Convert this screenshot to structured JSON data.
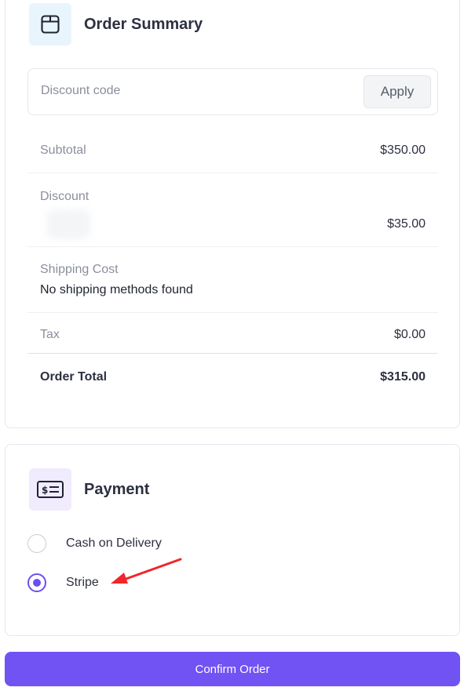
{
  "order_summary": {
    "title": "Order Summary",
    "icon": "box-icon",
    "discount": {
      "placeholder": "Discount code",
      "value": "",
      "apply_label": "Apply"
    },
    "rows": {
      "subtotal": {
        "label": "Subtotal",
        "value": "$350.00"
      },
      "discount": {
        "label": "Discount",
        "value": "$35.00"
      },
      "shipping": {
        "label": "Shipping Cost",
        "value": "No shipping methods found"
      },
      "tax": {
        "label": "Tax",
        "value": "$0.00"
      },
      "total": {
        "label": "Order Total",
        "value": "$315.00"
      }
    }
  },
  "payment": {
    "title": "Payment",
    "icon": "banknote-icon",
    "methods": [
      {
        "label": "Cash on Delivery",
        "selected": false
      },
      {
        "label": "Stripe",
        "selected": true
      }
    ]
  },
  "annotation": {
    "type": "red-arrow",
    "color": "#f0262a",
    "points_to": "Stripe"
  },
  "colors": {
    "accent": "#7152f3",
    "border": "#e6e8ee",
    "muted_text": "#8a8f9c"
  },
  "confirm_label": "Confirm Order"
}
